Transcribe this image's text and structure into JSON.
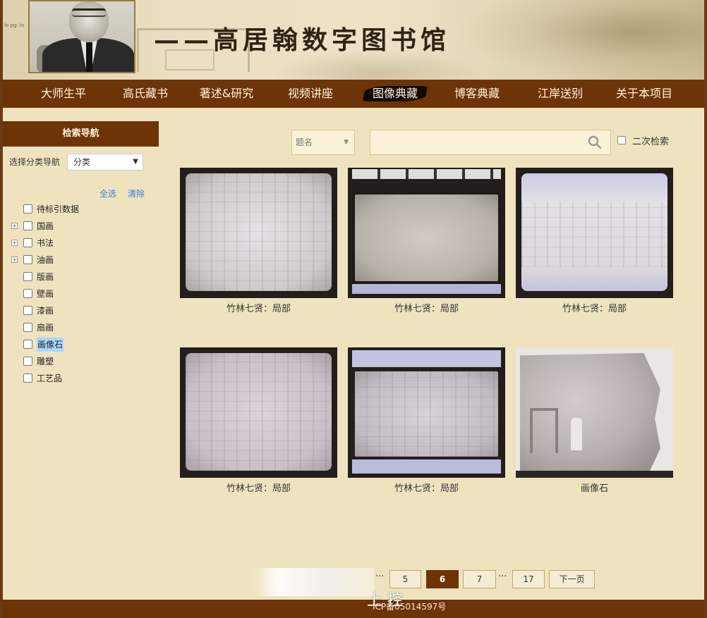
{
  "banner": {
    "title": "——高居翰数字图书馆",
    "tiny_text": "lo pg: lo"
  },
  "nav": {
    "items": [
      "大师生平",
      "高氏藏书",
      "著述&研究",
      "视频讲座",
      "图像典藏",
      "博客典藏",
      "江岸送别",
      "关于本项目"
    ],
    "active": "图像典藏"
  },
  "sidebar": {
    "header": "检索导航",
    "category_label": "选择分类导航",
    "category_value": "分类",
    "select_all": "全选",
    "clear": "清除",
    "tree": [
      {
        "label": "待标引数据",
        "expandable": false
      },
      {
        "label": "国画",
        "expandable": true
      },
      {
        "label": "书法",
        "expandable": true
      },
      {
        "label": "油画",
        "expandable": true
      },
      {
        "label": "版画",
        "expandable": false
      },
      {
        "label": "壁画",
        "expandable": false
      },
      {
        "label": "漆画",
        "expandable": false
      },
      {
        "label": "扇画",
        "expandable": false
      },
      {
        "label": "画像石",
        "expandable": false,
        "highlighted": true
      },
      {
        "label": "雕塑",
        "expandable": false
      },
      {
        "label": "工艺品",
        "expandable": false
      }
    ]
  },
  "search": {
    "field_value": "题名",
    "query": "",
    "secondary_search_label": "二次检索"
  },
  "gallery": {
    "items": [
      {
        "caption": "竹林七贤：局部"
      },
      {
        "caption": "竹林七贤：局部"
      },
      {
        "caption": "竹林七贤：局部"
      },
      {
        "caption": "竹林七贤：局部"
      },
      {
        "caption": "竹林七贤：局部"
      },
      {
        "caption": "画像石"
      }
    ]
  },
  "pagination": {
    "pages": [
      "5",
      "6",
      "7",
      "17"
    ],
    "current": "6",
    "ellipsis": "···",
    "next_label": "下一页"
  },
  "footer": {
    "icp": "ICP备05014597号",
    "overlay_char": "上 控"
  },
  "colors": {
    "brand_brown": "#6d3408",
    "page_bg": "#efe3bf",
    "link_blue": "#3a7bd5"
  }
}
